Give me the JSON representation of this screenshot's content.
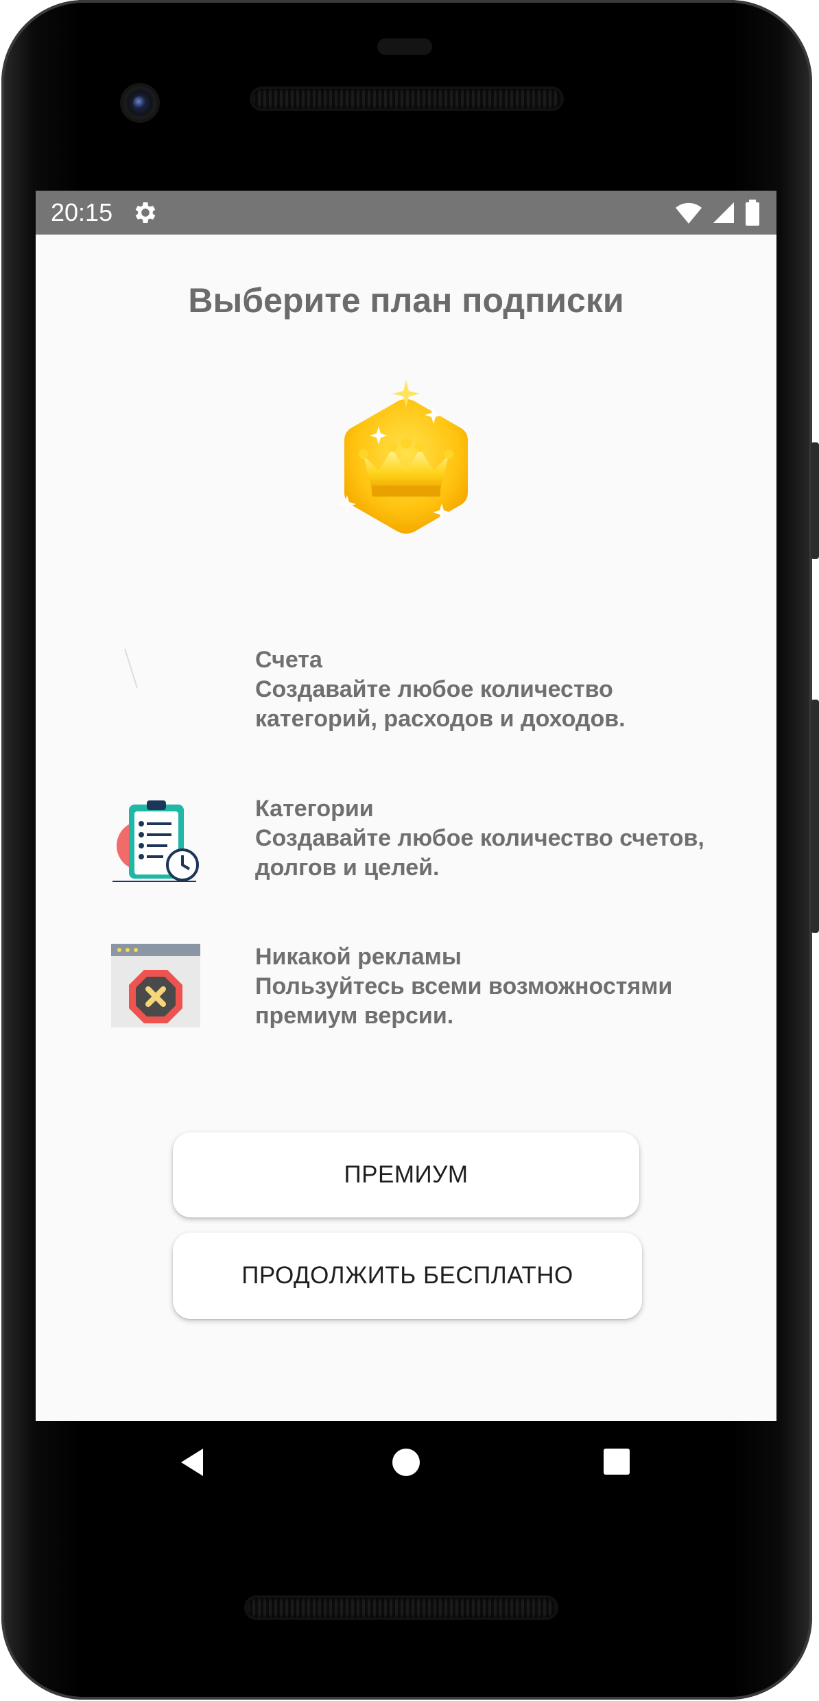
{
  "status_bar": {
    "time": "20:15",
    "icons": [
      "gear-icon",
      "wifi-icon",
      "signal-icon",
      "battery-icon"
    ]
  },
  "page": {
    "title": "Выберите план подписки",
    "hero_icon": "crown-badge-icon"
  },
  "features": [
    {
      "icon": "accounts-icon",
      "title": "Счета",
      "line1": "Создавайте любое количество",
      "line2": "категорий, расходов и доходов."
    },
    {
      "icon": "clipboard-clock-icon",
      "title": "Категории",
      "line1": "Создавайте любое количество счетов,",
      "line2": "долгов и целей."
    },
    {
      "icon": "no-ads-icon",
      "title": "Никакой рекламы",
      "line1": "Пользуйтесь всеми возможностями",
      "line2": "премиум версии."
    }
  ],
  "buttons": {
    "premium": "ПРЕМИУМ",
    "continue_free": "ПРОДОЛЖИТЬ БЕСПЛАТНО"
  },
  "nav_bar": {
    "icons": [
      "back-icon",
      "home-icon",
      "recents-icon"
    ]
  },
  "colors": {
    "status_bar": "#757575",
    "screen_bg": "#fafafa",
    "text_gray": "#6f6f6f",
    "crown_yellow": "#ffc61a"
  }
}
